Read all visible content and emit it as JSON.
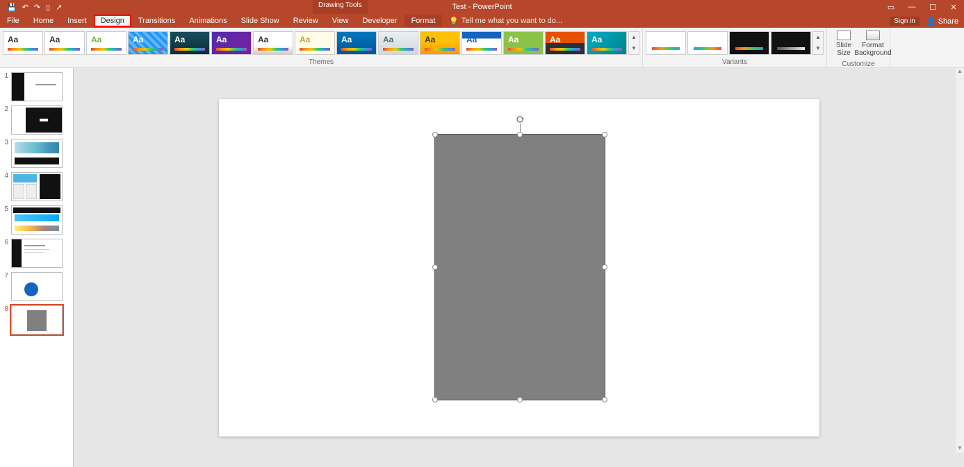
{
  "app": {
    "title": "Test - PowerPoint",
    "tool_context": "Drawing Tools"
  },
  "qat": {
    "save": "💾",
    "undo": "↶",
    "redo": "↷",
    "start": "▯",
    "touch": "↗"
  },
  "win": {
    "ribbon_opts": "▭",
    "min": "—",
    "max": "☐",
    "close": "✕"
  },
  "menu": {
    "file": "File",
    "home": "Home",
    "insert": "Insert",
    "design": "Design",
    "transitions": "Transitions",
    "animations": "Animations",
    "slideshow": "Slide Show",
    "review": "Review",
    "view": "View",
    "developer": "Developer",
    "format": "Format",
    "tellme": "Tell me what you want to do...",
    "signin": "Sign in",
    "share": "Share"
  },
  "ribbon": {
    "themes_label": "Themes",
    "variants_label": "Variants",
    "customize_label": "Customize",
    "slide_size": "Slide Size",
    "format_bg": "Format Background",
    "aa": "Aa"
  },
  "slides": {
    "count": 8,
    "selected": 8,
    "nums": [
      "1",
      "2",
      "3",
      "4",
      "5",
      "6",
      "7",
      "8"
    ]
  }
}
